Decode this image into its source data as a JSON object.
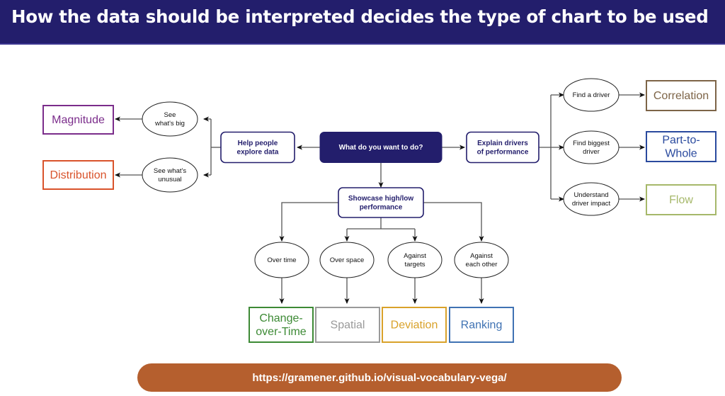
{
  "header": {
    "title": "How the data should be interpreted decides the type of chart to be used"
  },
  "colors": {
    "header_bg": "#231e6c",
    "navy": "#231e6c",
    "url_pill": "#b55f2e",
    "magnitude": "#7b2d8b",
    "distribution": "#d9532b",
    "correlation": "#7d6447",
    "part_to_whole": "#2a4a9e",
    "flow": "#a6b86a",
    "change_over_time": "#3d8a35",
    "spatial": "#9a9a9a",
    "deviation": "#d9a22a",
    "ranking": "#3f72b3"
  },
  "diagram": {
    "root": {
      "label": "What do you want to do?"
    },
    "branches": {
      "explore": {
        "label_lines": [
          "Help people",
          "explore data"
        ],
        "questions": [
          {
            "label_lines": [
              "See",
              "what's big"
            ],
            "result_lines": [
              "Magnitude"
            ],
            "color_key": "magnitude"
          },
          {
            "label_lines": [
              "See what's",
              "unusual"
            ],
            "result_lines": [
              "Distribution"
            ],
            "color_key": "distribution"
          }
        ]
      },
      "drivers": {
        "label_lines": [
          "Explain drivers",
          "of performance"
        ],
        "questions": [
          {
            "label_lines": [
              "Find a driver"
            ],
            "result_lines": [
              "Correlation"
            ],
            "color_key": "correlation"
          },
          {
            "label_lines": [
              "Find biggest",
              "driver"
            ],
            "result_lines": [
              "Part-to-",
              "Whole"
            ],
            "color_key": "part_to_whole"
          },
          {
            "label_lines": [
              "Understand",
              "driver impact"
            ],
            "result_lines": [
              "Flow"
            ],
            "color_key": "flow"
          }
        ]
      },
      "showcase": {
        "label_lines": [
          "Showcase high/low",
          "performance"
        ],
        "questions": [
          {
            "label_lines": [
              "Over time"
            ],
            "result_lines": [
              "Change-",
              "over-Time"
            ],
            "color_key": "change_over_time"
          },
          {
            "label_lines": [
              "Over space"
            ],
            "result_lines": [
              "Spatial"
            ],
            "color_key": "spatial"
          },
          {
            "label_lines": [
              "Against",
              "targets"
            ],
            "result_lines": [
              "Deviation"
            ],
            "color_key": "deviation"
          },
          {
            "label_lines": [
              "Against",
              "each other"
            ],
            "result_lines": [
              "Ranking"
            ],
            "color_key": "ranking"
          }
        ]
      }
    }
  },
  "footer": {
    "url": "https://gramener.github.io/visual-vocabulary-vega/"
  }
}
